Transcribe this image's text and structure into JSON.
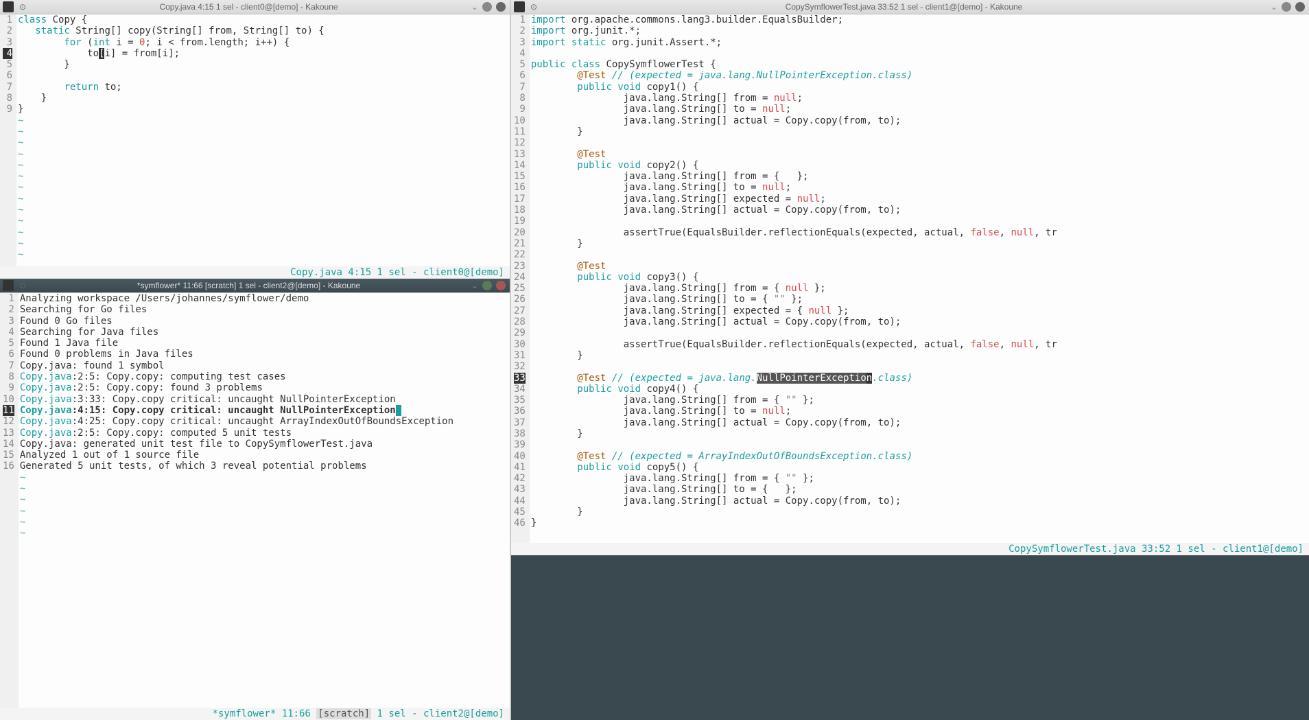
{
  "left_top": {
    "title": "Copy.java 4:15 1 sel - client0@[demo] - Kakoune",
    "status": "Copy.java 4:15  1 sel - client0@[demo]",
    "lines": [
      {
        "n": "1",
        "segs": [
          [
            "kw",
            "class"
          ],
          [
            "",
            " Copy {"
          ]
        ]
      },
      {
        "n": "2",
        "segs": [
          [
            "",
            "   "
          ],
          [
            "kw",
            "static"
          ],
          [
            "",
            " String[] copy(String[] from, String[] to) {"
          ]
        ]
      },
      {
        "n": "3",
        "segs": [
          [
            "",
            "        "
          ],
          [
            "kw",
            "for"
          ],
          [
            "",
            " ("
          ],
          [
            "ty",
            "int"
          ],
          [
            "",
            " i = "
          ],
          [
            "num",
            "0"
          ],
          [
            "",
            "; i < from.length; i++) {"
          ]
        ]
      },
      {
        "n": "4",
        "hl": true,
        "segs": [
          [
            "",
            "            to"
          ],
          [
            "curs",
            "["
          ],
          [
            "",
            "i] = from[i];"
          ]
        ]
      },
      {
        "n": "5",
        "segs": [
          [
            "",
            "        }"
          ]
        ]
      },
      {
        "n": "6",
        "segs": [
          [
            "",
            ""
          ]
        ]
      },
      {
        "n": "7",
        "segs": [
          [
            "",
            "        "
          ],
          [
            "kw",
            "return"
          ],
          [
            "",
            " to;"
          ]
        ]
      },
      {
        "n": "8",
        "segs": [
          [
            "",
            "    }"
          ]
        ]
      },
      {
        "n": "9",
        "segs": [
          [
            "",
            "}"
          ]
        ]
      }
    ]
  },
  "left_bottom": {
    "title": "*symflower* 11:66 [scratch] 1 sel - client2@[demo] - Kakoune",
    "status_pre": "*symflower* 11:66 ",
    "status_scratch": "[scratch]",
    "status_post": " 1 sel - client2@[demo]",
    "lines": [
      {
        "n": "1",
        "segs": [
          [
            "",
            "Analyzing workspace /Users/johannes/symflower/demo"
          ]
        ]
      },
      {
        "n": "2",
        "segs": [
          [
            "",
            "Searching for Go files"
          ]
        ]
      },
      {
        "n": "3",
        "segs": [
          [
            "",
            "Found 0 Go files"
          ]
        ]
      },
      {
        "n": "4",
        "segs": [
          [
            "",
            "Searching for Java files"
          ]
        ]
      },
      {
        "n": "5",
        "segs": [
          [
            "",
            "Found 1 Java file"
          ]
        ]
      },
      {
        "n": "6",
        "segs": [
          [
            "",
            "Found 0 problems in Java files"
          ]
        ]
      },
      {
        "n": "7",
        "segs": [
          [
            "",
            "Copy.java: found 1 symbol"
          ]
        ]
      },
      {
        "n": "8",
        "segs": [
          [
            "link",
            "Copy.java"
          ],
          [
            "",
            ":2:5: Copy.copy: computing test cases"
          ]
        ]
      },
      {
        "n": "9",
        "segs": [
          [
            "link",
            "Copy.java"
          ],
          [
            "",
            ":2:5: Copy.copy: found 3 problems"
          ]
        ]
      },
      {
        "n": "10",
        "segs": [
          [
            "link",
            "Copy.java"
          ],
          [
            "",
            ":3:33: Copy.copy critical: uncaught NullPointerException"
          ]
        ]
      },
      {
        "n": "11",
        "hl": true,
        "segs": [
          [
            "link hlline",
            "Copy.java"
          ],
          [
            "hlline",
            ":4:15: Copy.copy critical: uncaught NullPointerException"
          ],
          [
            "hlcurs",
            " "
          ]
        ]
      },
      {
        "n": "12",
        "segs": [
          [
            "link",
            "Copy.java"
          ],
          [
            "",
            ":4:25: Copy.copy critical: uncaught ArrayIndexOutOfBoundsException"
          ]
        ]
      },
      {
        "n": "13",
        "segs": [
          [
            "link",
            "Copy.java"
          ],
          [
            "",
            ":2:5: Copy.copy: computed 5 unit tests"
          ]
        ]
      },
      {
        "n": "14",
        "segs": [
          [
            "",
            "Copy.java: generated unit test file to CopySymflowerTest.java"
          ]
        ]
      },
      {
        "n": "15",
        "segs": [
          [
            "",
            "Analyzed 1 out of 1 source file"
          ]
        ]
      },
      {
        "n": "16",
        "segs": [
          [
            "",
            "Generated 5 unit tests, of which 3 reveal potential problems"
          ]
        ]
      }
    ]
  },
  "right": {
    "title": "CopySymflowerTest.java 33:52 1 sel - client1@[demo] - Kakoune",
    "status": "CopySymflowerTest.java 33:52  1 sel - client1@[demo]",
    "lines": [
      {
        "n": "1",
        "segs": [
          [
            "kw",
            "import"
          ],
          [
            "",
            " org.apache.commons.lang3.builder.EqualsBuilder;"
          ]
        ]
      },
      {
        "n": "2",
        "segs": [
          [
            "kw",
            "import"
          ],
          [
            "",
            " org.junit.*;"
          ]
        ]
      },
      {
        "n": "3",
        "segs": [
          [
            "kw",
            "import"
          ],
          [
            "",
            " "
          ],
          [
            "kw",
            "static"
          ],
          [
            "",
            " org.junit.Assert.*;"
          ]
        ]
      },
      {
        "n": "4",
        "segs": [
          [
            "",
            ""
          ]
        ]
      },
      {
        "n": "5",
        "segs": [
          [
            "kw",
            "public"
          ],
          [
            "",
            " "
          ],
          [
            "kw",
            "class"
          ],
          [
            "",
            " CopySymflowerTest {"
          ]
        ]
      },
      {
        "n": "6",
        "segs": [
          [
            "",
            "        "
          ],
          [
            "ann",
            "@Test"
          ],
          [
            "",
            " "
          ],
          [
            "cm",
            "// (expected = java.lang.NullPointerException.class)"
          ]
        ]
      },
      {
        "n": "7",
        "segs": [
          [
            "",
            "        "
          ],
          [
            "kw",
            "public"
          ],
          [
            "",
            " "
          ],
          [
            "kw",
            "void"
          ],
          [
            "",
            " copy1() {"
          ]
        ]
      },
      {
        "n": "8",
        "segs": [
          [
            "",
            "                java.lang.String[] from = "
          ],
          [
            "nl",
            "null"
          ],
          [
            "",
            ";"
          ]
        ]
      },
      {
        "n": "9",
        "segs": [
          [
            "",
            "                java.lang.String[] to = "
          ],
          [
            "nl",
            "null"
          ],
          [
            "",
            ";"
          ]
        ]
      },
      {
        "n": "10",
        "segs": [
          [
            "",
            "                java.lang.String[] actual = Copy.copy(from, to);"
          ]
        ]
      },
      {
        "n": "11",
        "segs": [
          [
            "",
            "        }"
          ]
        ]
      },
      {
        "n": "12",
        "segs": [
          [
            "",
            ""
          ]
        ]
      },
      {
        "n": "13",
        "segs": [
          [
            "",
            "        "
          ],
          [
            "ann",
            "@Test"
          ]
        ]
      },
      {
        "n": "14",
        "segs": [
          [
            "",
            "        "
          ],
          [
            "kw",
            "public"
          ],
          [
            "",
            " "
          ],
          [
            "kw",
            "void"
          ],
          [
            "",
            " copy2() {"
          ]
        ]
      },
      {
        "n": "15",
        "segs": [
          [
            "",
            "                java.lang.String[] from = {   };"
          ]
        ]
      },
      {
        "n": "16",
        "segs": [
          [
            "",
            "                java.lang.String[] to = "
          ],
          [
            "nl",
            "null"
          ],
          [
            "",
            ";"
          ]
        ]
      },
      {
        "n": "17",
        "segs": [
          [
            "",
            "                java.lang.String[] expected = "
          ],
          [
            "nl",
            "null"
          ],
          [
            "",
            ";"
          ]
        ]
      },
      {
        "n": "18",
        "segs": [
          [
            "",
            "                java.lang.String[] actual = Copy.copy(from, to);"
          ]
        ]
      },
      {
        "n": "19",
        "segs": [
          [
            "",
            ""
          ]
        ]
      },
      {
        "n": "20",
        "segs": [
          [
            "",
            "                assertTrue(EqualsBuilder.reflectionEquals(expected, actual, "
          ],
          [
            "nl",
            "false"
          ],
          [
            "",
            ", "
          ],
          [
            "nl",
            "null"
          ],
          [
            "",
            ", tr"
          ]
        ]
      },
      {
        "n": "21",
        "segs": [
          [
            "",
            "        }"
          ]
        ]
      },
      {
        "n": "22",
        "segs": [
          [
            "",
            ""
          ]
        ]
      },
      {
        "n": "23",
        "segs": [
          [
            "",
            "        "
          ],
          [
            "ann",
            "@Test"
          ]
        ]
      },
      {
        "n": "24",
        "segs": [
          [
            "",
            "        "
          ],
          [
            "kw",
            "public"
          ],
          [
            "",
            " "
          ],
          [
            "kw",
            "void"
          ],
          [
            "",
            " copy3() {"
          ]
        ]
      },
      {
        "n": "25",
        "segs": [
          [
            "",
            "                java.lang.String[] from = { "
          ],
          [
            "nl",
            "null"
          ],
          [
            "",
            " };"
          ]
        ]
      },
      {
        "n": "26",
        "segs": [
          [
            "",
            "                java.lang.String[] to = { "
          ],
          [
            "str",
            "\"\""
          ],
          [
            "",
            " };"
          ]
        ]
      },
      {
        "n": "27",
        "segs": [
          [
            "",
            "                java.lang.String[] expected = { "
          ],
          [
            "nl",
            "null"
          ],
          [
            "",
            " };"
          ]
        ]
      },
      {
        "n": "28",
        "segs": [
          [
            "",
            "                java.lang.String[] actual = Copy.copy(from, to);"
          ]
        ]
      },
      {
        "n": "29",
        "segs": [
          [
            "",
            ""
          ]
        ]
      },
      {
        "n": "30",
        "segs": [
          [
            "",
            "                assertTrue(EqualsBuilder.reflectionEquals(expected, actual, "
          ],
          [
            "nl",
            "false"
          ],
          [
            "",
            ", "
          ],
          [
            "nl",
            "null"
          ],
          [
            "",
            ", tr"
          ]
        ]
      },
      {
        "n": "31",
        "segs": [
          [
            "",
            "        }"
          ]
        ]
      },
      {
        "n": "32",
        "segs": [
          [
            "",
            ""
          ]
        ]
      },
      {
        "n": "33",
        "hl": true,
        "segs": [
          [
            "",
            "        "
          ],
          [
            "ann",
            "@Test"
          ],
          [
            "",
            " "
          ],
          [
            "cm",
            "// (expected = java.lang."
          ],
          [
            "sel",
            "NullPointerExceptio"
          ],
          [
            "curs",
            "n"
          ],
          [
            "cm",
            ".class)"
          ]
        ]
      },
      {
        "n": "34",
        "segs": [
          [
            "",
            "        "
          ],
          [
            "kw",
            "public"
          ],
          [
            "",
            " "
          ],
          [
            "kw",
            "void"
          ],
          [
            "",
            " copy4() {"
          ]
        ]
      },
      {
        "n": "35",
        "segs": [
          [
            "",
            "                java.lang.String[] from = { "
          ],
          [
            "str",
            "\"\""
          ],
          [
            "",
            " };"
          ]
        ]
      },
      {
        "n": "36",
        "segs": [
          [
            "",
            "                java.lang.String[] to = "
          ],
          [
            "nl",
            "null"
          ],
          [
            "",
            ";"
          ]
        ]
      },
      {
        "n": "37",
        "segs": [
          [
            "",
            "                java.lang.String[] actual = Copy.copy(from, to);"
          ]
        ]
      },
      {
        "n": "38",
        "segs": [
          [
            "",
            "        }"
          ]
        ]
      },
      {
        "n": "39",
        "segs": [
          [
            "",
            ""
          ]
        ]
      },
      {
        "n": "40",
        "segs": [
          [
            "",
            "        "
          ],
          [
            "ann",
            "@Test"
          ],
          [
            "",
            " "
          ],
          [
            "cm",
            "// (expected = ArrayIndexOutOfBoundsException.class)"
          ]
        ]
      },
      {
        "n": "41",
        "segs": [
          [
            "",
            "        "
          ],
          [
            "kw",
            "public"
          ],
          [
            "",
            " "
          ],
          [
            "kw",
            "void"
          ],
          [
            "",
            " copy5() {"
          ]
        ]
      },
      {
        "n": "42",
        "segs": [
          [
            "",
            "                java.lang.String[] from = { "
          ],
          [
            "str",
            "\"\""
          ],
          [
            "",
            " };"
          ]
        ]
      },
      {
        "n": "43",
        "segs": [
          [
            "",
            "                java.lang.String[] to = {   };"
          ]
        ]
      },
      {
        "n": "44",
        "segs": [
          [
            "",
            "                java.lang.String[] actual = Copy.copy(from, to);"
          ]
        ]
      },
      {
        "n": "45",
        "segs": [
          [
            "",
            "        }"
          ]
        ]
      },
      {
        "n": "46",
        "segs": [
          [
            "",
            "}"
          ]
        ]
      }
    ]
  }
}
